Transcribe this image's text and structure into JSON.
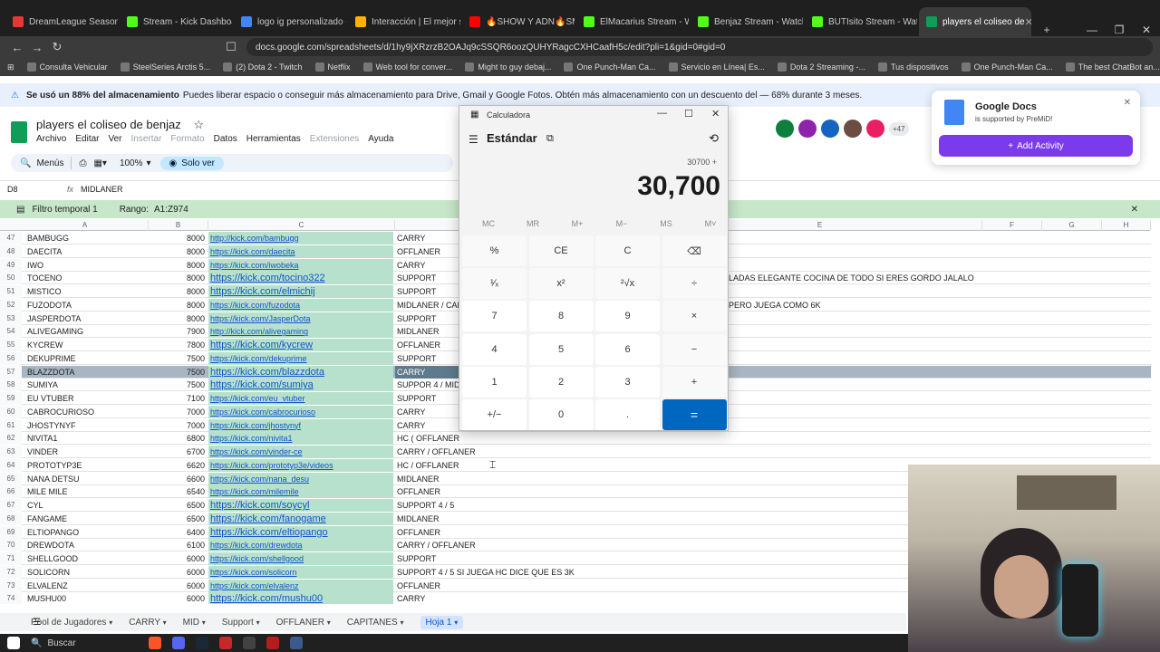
{
  "browser": {
    "tabs": [
      {
        "title": "DreamLeague Season 25",
        "color": "#e53935"
      },
      {
        "title": "Stream - Kick Dashboard",
        "color": "#53fc18"
      },
      {
        "title": "logo ig personalizado - B",
        "color": "#4285f4"
      },
      {
        "title": "Interacción | El mejor soft",
        "color": "#ffb300"
      },
      {
        "title": "🔥SHOW Y ADN🔥SMASH",
        "color": "#ff0000"
      },
      {
        "title": "ElMacarius Stream - Watc",
        "color": "#53fc18"
      },
      {
        "title": "Benjaz Stream - Watch",
        "color": "#53fc18"
      },
      {
        "title": "BUTIsito Stream - Watch",
        "color": "#53fc18"
      },
      {
        "title": "players el coliseo de",
        "color": "#0f9d58",
        "active": true
      }
    ],
    "url": "docs.google.com/spreadsheets/d/1hy9jXRzrzB2OAJq9cSSQR6oozQUHYRagcCXHCaafH5c/edit?pli=1&gid=0#gid=0",
    "bookmarks": [
      "Consulta Vehicular",
      "SteelSeries Arctis 5...",
      "(2) Dota 2 - Twitch",
      "Netflix",
      "Web tool for conver...",
      "Might to guy debaj...",
      "One Punch-Man Ca...",
      "Servicio en Línea| Es...",
      "Dota 2 Streaming -...",
      "Tus dispositivos",
      "One Punch-Man Ca...",
      "The best ChatBot an..."
    ]
  },
  "banner": {
    "bold": "Se usó un 88% del almacenamiento",
    "text": "Puedes liberar espacio o conseguir más almacenamiento para Drive, Gmail y Google Fotos. Obtén más almacenamiento con un descuento del — 68% durante 3 meses."
  },
  "sheet": {
    "title": "players el coliseo de benjaz",
    "menu": [
      "Archivo",
      "Editar",
      "Ver",
      "Insertar",
      "Formato",
      "Datos",
      "Herramientas",
      "Extensiones",
      "Ayuda"
    ],
    "menu_disabled": [
      false,
      false,
      false,
      true,
      true,
      false,
      false,
      true,
      false
    ],
    "toolbar": {
      "menus": "Menús",
      "zoom": "100%",
      "view_only": "Solo ver"
    },
    "namebox": "D8",
    "formula": "MIDLANER",
    "filter": {
      "label": "Filtro temporal 1",
      "range_label": "Rango:",
      "range": "A1:Z974"
    },
    "columns": [
      "A",
      "B",
      "C",
      "D",
      "E",
      "F",
      "G",
      "H"
    ],
    "rows": [
      {
        "n": "47",
        "a": "BAMBUGG",
        "b": "8000",
        "c": "http://kick.com/bambugg",
        "d": "CARRY",
        "e": ""
      },
      {
        "n": "48",
        "a": "DAECITA",
        "b": "8000",
        "c": "https://kick.com/daecita",
        "d": "OFFLANER",
        "e": ""
      },
      {
        "n": "49",
        "a": "IWO",
        "b": "8000",
        "c": "https://kick.com/iwobeka",
        "d": "CARRY",
        "e": ""
      },
      {
        "n": "50",
        "a": "TOCENO",
        "b": "8000",
        "c": "https://kick.com/tocino322",
        "d": "SUPPORT",
        "e": "LADAS ELEGANTE COCINA DE TODO SI ERES GORDO JALALO",
        "big": true
      },
      {
        "n": "51",
        "a": "MISTICO",
        "b": "8000",
        "c": "https://kick.com/elmichij",
        "d": "SUPPORT",
        "e": "",
        "big": true
      },
      {
        "n": "52",
        "a": "FUZODOTA",
        "b": "8000",
        "c": "https://kick.com/fuzodota",
        "d": "MIDLANER / CAR",
        "e": "PERO JUEGA COMO 6K"
      },
      {
        "n": "53",
        "a": "JASPERDOTA",
        "b": "8000",
        "c": "https://kick.com/JasperDota",
        "d": "SUPPORT",
        "e": ""
      },
      {
        "n": "54",
        "a": "ALIVEGAMING",
        "b": "7900",
        "c": "http://kick.com/alivegaming",
        "d": "MIDLANER",
        "e": ""
      },
      {
        "n": "55",
        "a": "KYCREW",
        "b": "7800",
        "c": "https://kick.com/kycrew",
        "d": "OFFLANER",
        "e": "",
        "big": true
      },
      {
        "n": "56",
        "a": "DEKUPRIME",
        "b": "7500",
        "c": "https://kick.com/dekuprime",
        "d": "SUPPORT",
        "e": ""
      },
      {
        "n": "57",
        "a": "BLAZZDOTA",
        "b": "7500",
        "c": "https://kick.com/blazzdota",
        "d": "CARRY",
        "e": "",
        "big": true,
        "sel": true
      },
      {
        "n": "58",
        "a": "SUMIYA",
        "b": "7500",
        "c": "https://kick.com/sumiya",
        "d": "SUPPOR 4 / MID",
        "e": "",
        "big": true
      },
      {
        "n": "59",
        "a": "EU VTUBER",
        "b": "7100",
        "c": "https://kick.com/eu_vtuber",
        "d": "SUPPORT",
        "e": ""
      },
      {
        "n": "60",
        "a": "CABROCURIOSO",
        "b": "7000",
        "c": "https://kick.com/cabrocurioso",
        "d": "CARRY",
        "e": ""
      },
      {
        "n": "61",
        "a": "JHOSTYNYF",
        "b": "7000",
        "c": "https://kick.com/jhostynyf",
        "d": "CARRY",
        "e": ""
      },
      {
        "n": "62",
        "a": "NIVITA1",
        "b": "6800",
        "c": "https://kick.com/nivita1",
        "d": "HC ( OFFLANER",
        "e": ""
      },
      {
        "n": "63",
        "a": "VINDER",
        "b": "6700",
        "c": "https://kick.com/vinder-ce",
        "d": "CARRY / OFFLANER",
        "e": ""
      },
      {
        "n": "64",
        "a": "PROTOTYP3E",
        "b": "6620",
        "c": "https://kick.com/prototyp3e/videos",
        "d": "HC / OFFLANER",
        "e": ""
      },
      {
        "n": "65",
        "a": "NANA DETSU",
        "b": "6600",
        "c": "https://kick.com/nana_desu",
        "d": "MIDLANER",
        "e": ""
      },
      {
        "n": "66",
        "a": "MILE MILE",
        "b": "6540",
        "c": "https://kick.com/milemile",
        "d": "OFFLANER",
        "e": ""
      },
      {
        "n": "67",
        "a": "CYL",
        "b": "6500",
        "c": "https://kick.com/soycyl",
        "d": "SUPPORT 4 / 5",
        "e": "",
        "big": true
      },
      {
        "n": "68",
        "a": "FANGAME",
        "b": "6500",
        "c": "https://kick.com/fanogame",
        "d": "MIDLANER",
        "e": "",
        "big": true
      },
      {
        "n": "69",
        "a": "ELTIOPANGO",
        "b": "6400",
        "c": "https://kick.com/eltiopango",
        "d": "OFFLANER",
        "e": "",
        "big": true
      },
      {
        "n": "70",
        "a": "DREWDOTA",
        "b": "6100",
        "c": "https://kick.com/drewdota",
        "d": "CARRY / OFFLANER",
        "e": ""
      },
      {
        "n": "71",
        "a": "SHELLGOOD",
        "b": "6000",
        "c": "https://kick.com/shellgood",
        "d": "SUPPORT",
        "e": ""
      },
      {
        "n": "72",
        "a": "SOLICORN",
        "b": "6000",
        "c": "https://kick.com/solicorn",
        "d": "SUPPORT 4 / 5 SI JUEGA HC DICE QUE ES 3K",
        "e": ""
      },
      {
        "n": "73",
        "a": "ELVALENZ",
        "b": "6000",
        "c": "https://kick.com/elvalenz",
        "d": "OFFLANER",
        "e": ""
      },
      {
        "n": "74",
        "a": "MUSHU00",
        "b": "6000",
        "c": "https://kick.com/mushu00",
        "d": "CARRY",
        "e": "",
        "big": true
      }
    ],
    "tabs": [
      "Pool de Jugadores",
      "CARRY",
      "MID",
      "Support",
      "OFFLANER",
      "CAPITANES",
      "Hoja 1"
    ],
    "active_tab": "Hoja 1",
    "collaborators_extra": "+47"
  },
  "calculator": {
    "title": "Calculadora",
    "mode": "Estándar",
    "expression": "30700 +",
    "display": "30,700",
    "memory": [
      "MC",
      "MR",
      "M+",
      "M−",
      "MS",
      "M˅"
    ],
    "keys": [
      "%",
      "CE",
      "C",
      "⌫",
      "¹⁄ₓ",
      "x²",
      "²√x",
      "÷",
      "7",
      "8",
      "9",
      "×",
      "4",
      "5",
      "6",
      "−",
      "1",
      "2",
      "3",
      "+",
      "+/−",
      "0",
      ".",
      "="
    ]
  },
  "premid": {
    "title": "Google Docs",
    "subtitle": "is supported by PreMiD!",
    "button": "Add Activity"
  },
  "taskbar": {
    "search": "Buscar"
  }
}
